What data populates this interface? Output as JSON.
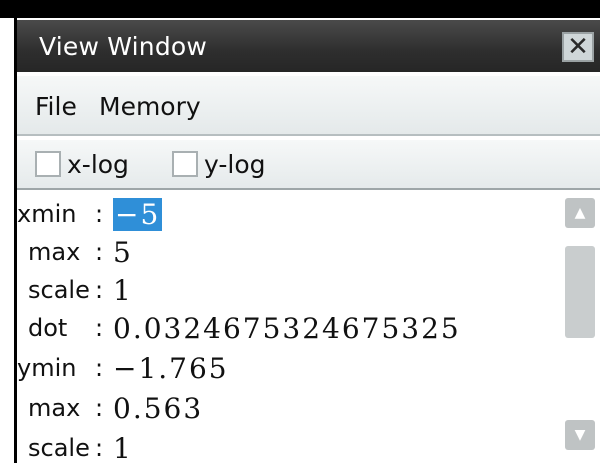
{
  "window": {
    "title": "View Window",
    "close_glyph": "✕"
  },
  "menu": {
    "items": [
      "File",
      "Memory"
    ]
  },
  "log_options": [
    {
      "label": "x-log",
      "checked": false
    },
    {
      "label": "y-log",
      "checked": false
    }
  ],
  "fields": [
    {
      "label": "xmin",
      "value": "−5",
      "selected": true
    },
    {
      "label": "max",
      "value": "5"
    },
    {
      "label": "scale",
      "value": "1"
    },
    {
      "label": "dot",
      "value": "0.0324675324675325"
    },
    {
      "label": "ymin",
      "value": "−1.765"
    },
    {
      "label": "max",
      "value": "0.563"
    },
    {
      "label": "scale",
      "value": "1"
    }
  ],
  "colors": {
    "selection": "#2f8fd8",
    "titlebar": "#2e2e2e"
  }
}
